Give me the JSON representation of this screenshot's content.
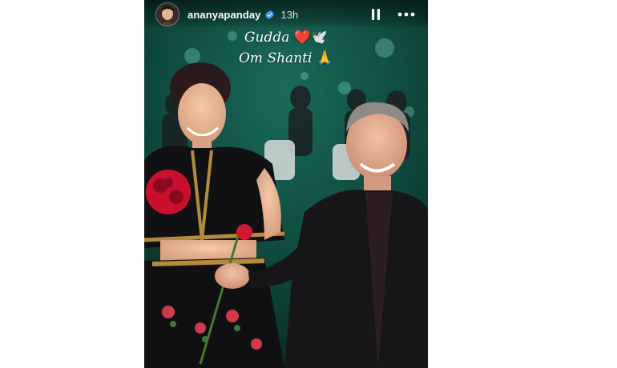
{
  "story": {
    "username": "ananyapanday",
    "time_ago": "13h",
    "verified": true,
    "caption_lines": [
      {
        "text": "Gudda",
        "emoji": "❤️🕊️"
      },
      {
        "text": "Om Shanti",
        "emoji": "🙏"
      }
    ],
    "icons": {
      "pause": "pause-icon",
      "more": "more-options-icon",
      "verified": "verified-badge-icon"
    },
    "colors": {
      "backdrop": "#0d3d34",
      "verified": "#3897f0"
    }
  }
}
